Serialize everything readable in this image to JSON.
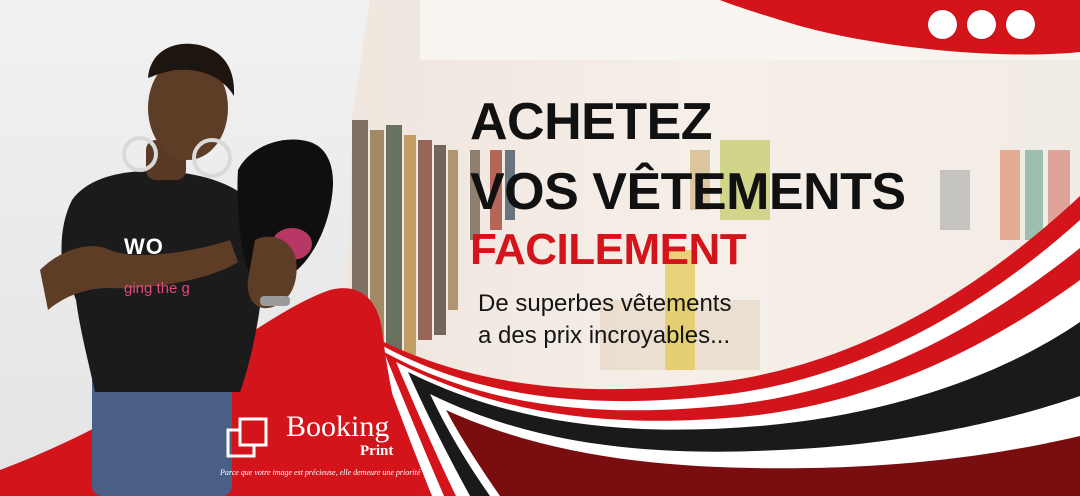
{
  "banner": {
    "headline_line1": "ACHETEZ",
    "headline_line2": "VOS VÊTEMENTS",
    "headline_line3": "FACILEMENT",
    "tagline_line1": "De superbes vêtements",
    "tagline_line2": "a des prix incroyables..."
  },
  "shirt_print": {
    "line1": "WO",
    "line2": "ging the g"
  },
  "logo": {
    "name": "Booking",
    "sub": "Print",
    "slogan": "Parce que votre image est précieuse, elle demeure une priorité"
  },
  "colors": {
    "brand_red": "#d4141b",
    "dark_red": "#7a0d10",
    "text_dark": "#111111",
    "white": "#ffffff"
  },
  "icons": [
    "three-dots-icon",
    "booking-print-logo-icon"
  ]
}
